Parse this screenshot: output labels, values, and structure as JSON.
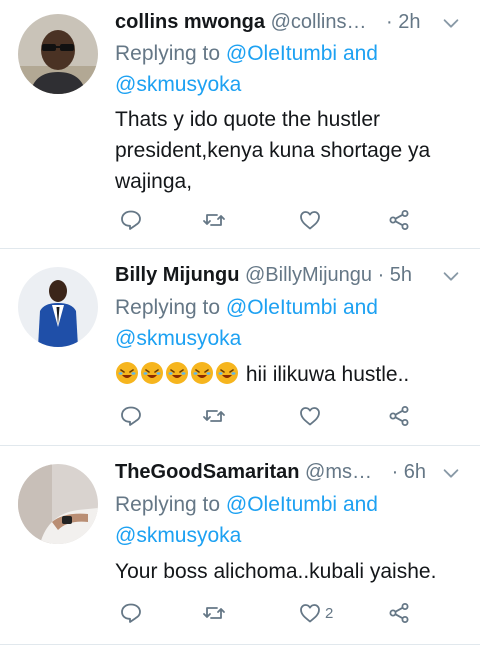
{
  "tweets": [
    {
      "name": "collins mwonga",
      "handle": "@collins…",
      "time": "· 2h",
      "reply_prefix": "Replying to",
      "reply_to_1": "@OleItumbi",
      "reply_and": "and",
      "reply_to_2": "@skmusyoka",
      "text_line1": "Thats y ido quote the hustler",
      "text_line2": "president,kenya kuna shortage ya",
      "text_line3": "wajinga,",
      "like_count": ""
    },
    {
      "name": "Billy Mijungu",
      "handle": "@BillyMijungu",
      "time": "· 5h",
      "reply_prefix": "Replying to",
      "reply_to_1": "@OleItumbi",
      "reply_and": "and",
      "reply_to_2": "@skmusyoka",
      "emoji_text": "🤣🤣🤣🤣🤣",
      "text_after_emoji": "hii ilikuwa hustle..",
      "like_count": ""
    },
    {
      "name": "TheGoodSamaritan",
      "handle": "@ms…",
      "time": "· 6h",
      "reply_prefix": "Replying to",
      "reply_to_1": "@OleItumbi",
      "reply_and": "and",
      "reply_to_2": "@skmusyoka",
      "text_line1": "Your boss alichoma..kubali yaishe.",
      "like_count": "2"
    }
  ],
  "icons": {
    "reply": "reply-icon",
    "retweet": "retweet-icon",
    "like": "heart-icon",
    "share": "share-icon",
    "more": "chevron-down-icon"
  },
  "colors": {
    "link": "#1da1f2",
    "muted": "#657786",
    "text": "#14171a",
    "separator": "#e1e8ed"
  }
}
